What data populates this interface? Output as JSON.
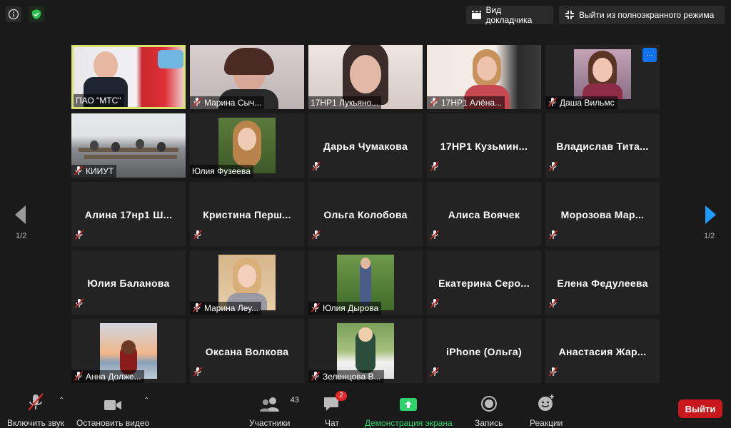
{
  "topbar": {
    "speaker_view": "Вид докладчика",
    "exit_fullscreen": "Выйти из полноэкранного режима"
  },
  "pagination": {
    "left": "1/2",
    "right": "1/2"
  },
  "tiles": [
    {
      "name": "ПАО \"МТС\"",
      "type": "video",
      "active": true
    },
    {
      "name": "Марина Сыч...",
      "type": "video"
    },
    {
      "name": "17НР1 Лукьяно...",
      "type": "video"
    },
    {
      "name": "17НР1 Алёна...",
      "type": "video"
    },
    {
      "name": "Даша Вильмс",
      "type": "video"
    },
    {
      "name": "КИИУТ",
      "type": "video"
    },
    {
      "name": "Юлия Фузеева",
      "type": "photo"
    },
    {
      "name": "Дарья Чумакова",
      "type": "text"
    },
    {
      "name": "17НР1 Кузьмин...",
      "type": "text"
    },
    {
      "name": "Владислав Тита...",
      "type": "text"
    },
    {
      "name": "Алина 17нр1 Ш...",
      "type": "text"
    },
    {
      "name": "Кристина Перш...",
      "type": "text"
    },
    {
      "name": "Ольга Колобова",
      "type": "text"
    },
    {
      "name": "Алиса Воячек",
      "type": "text"
    },
    {
      "name": "Морозова Мар...",
      "type": "text"
    },
    {
      "name": "Юлия Баланова",
      "type": "text"
    },
    {
      "name": "Марина Леу...",
      "type": "photo"
    },
    {
      "name": "Юлия Дырова",
      "type": "photo"
    },
    {
      "name": "Екатерина Серо...",
      "type": "text"
    },
    {
      "name": "Елена Федулеева",
      "type": "text"
    },
    {
      "name": "Анна Долже...",
      "type": "photo"
    },
    {
      "name": "Оксана Волкова",
      "type": "text"
    },
    {
      "name": "Зеленцова В...",
      "type": "photo"
    },
    {
      "name": "iPhone (Ольга)",
      "type": "text"
    },
    {
      "name": "Анастасия Жар...",
      "type": "text"
    }
  ],
  "toolbar": {
    "unmute": "Включить звук",
    "stop_video": "Остановить видео",
    "participants": "Участники",
    "participants_count": "43",
    "chat": "Чат",
    "chat_badge": "2",
    "share_screen": "Демонстрация экрана",
    "record": "Запись",
    "reactions": "Реакции",
    "leave": "Выйти"
  },
  "colors": {
    "active_border": "#d7e36a",
    "share_green": "#2fd36b",
    "leave_red": "#c8171d",
    "accent_blue": "#0e72ed",
    "mute_red": "#e02828"
  }
}
